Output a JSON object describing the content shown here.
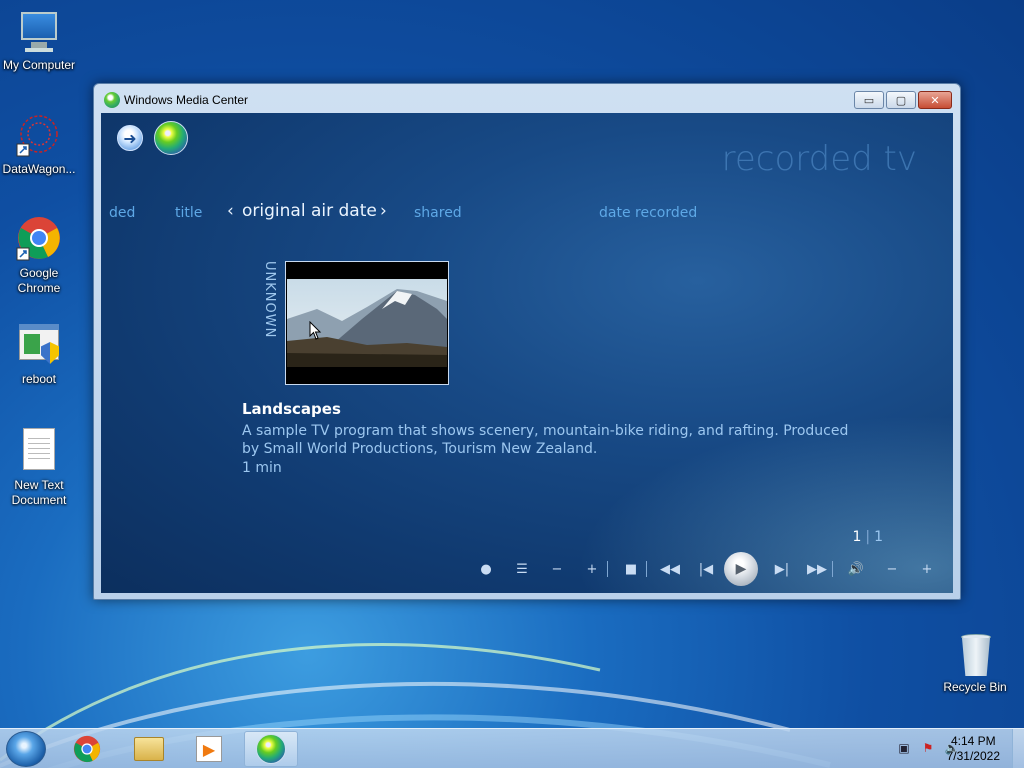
{
  "desktop": {
    "icons": [
      {
        "label": "My Computer",
        "icon": "computer-icon"
      },
      {
        "label": "DataWagon...",
        "icon": "datawagon-icon"
      },
      {
        "label": "Google Chrome",
        "icon": "chrome-icon"
      },
      {
        "label": "reboot",
        "icon": "reboot-icon"
      },
      {
        "label": "New Text Document",
        "icon": "text-document-icon"
      },
      {
        "label": "Recycle Bin",
        "icon": "recycle-bin-icon"
      }
    ]
  },
  "window": {
    "title": "Windows Media Center",
    "buttons": {
      "minimize": "▭",
      "maximize": "▢",
      "close": "✕"
    }
  },
  "media_center": {
    "section_title": "recorded tv",
    "sort_options": {
      "prev_partial": "ded",
      "title": "title",
      "current": "original air date",
      "left_arrow": "‹",
      "right_arrow": "›",
      "shared": "shared",
      "date_recorded": "date recorded"
    },
    "thumbnail_group_label": "UNKNOWN",
    "program": {
      "title": "Landscapes",
      "description": "A sample TV program that shows scenery, mountain-bike riding, and rafting. Produced by Small World Productions, Tourism New Zealand.",
      "duration": "1 min"
    },
    "pager": {
      "current": "1",
      "separator": "|",
      "total": "1"
    },
    "transport_icons": [
      "record-icon",
      "guide-icon",
      "channel-down-icon",
      "channel-up-icon",
      "stop-icon",
      "rewind-icon",
      "skip-back-icon",
      "play-icon",
      "skip-forward-icon",
      "fast-forward-icon",
      "mute-icon",
      "volume-down-icon",
      "volume-up-icon"
    ]
  },
  "taskbar": {
    "pinned": [
      "chrome-icon",
      "explorer-icon",
      "media-player-icon",
      "media-center-icon"
    ],
    "tray_icons": [
      "network-icon",
      "action-center-icon",
      "volume-icon"
    ],
    "clock": {
      "time": "4:14 PM",
      "date": "7/31/2022"
    }
  }
}
